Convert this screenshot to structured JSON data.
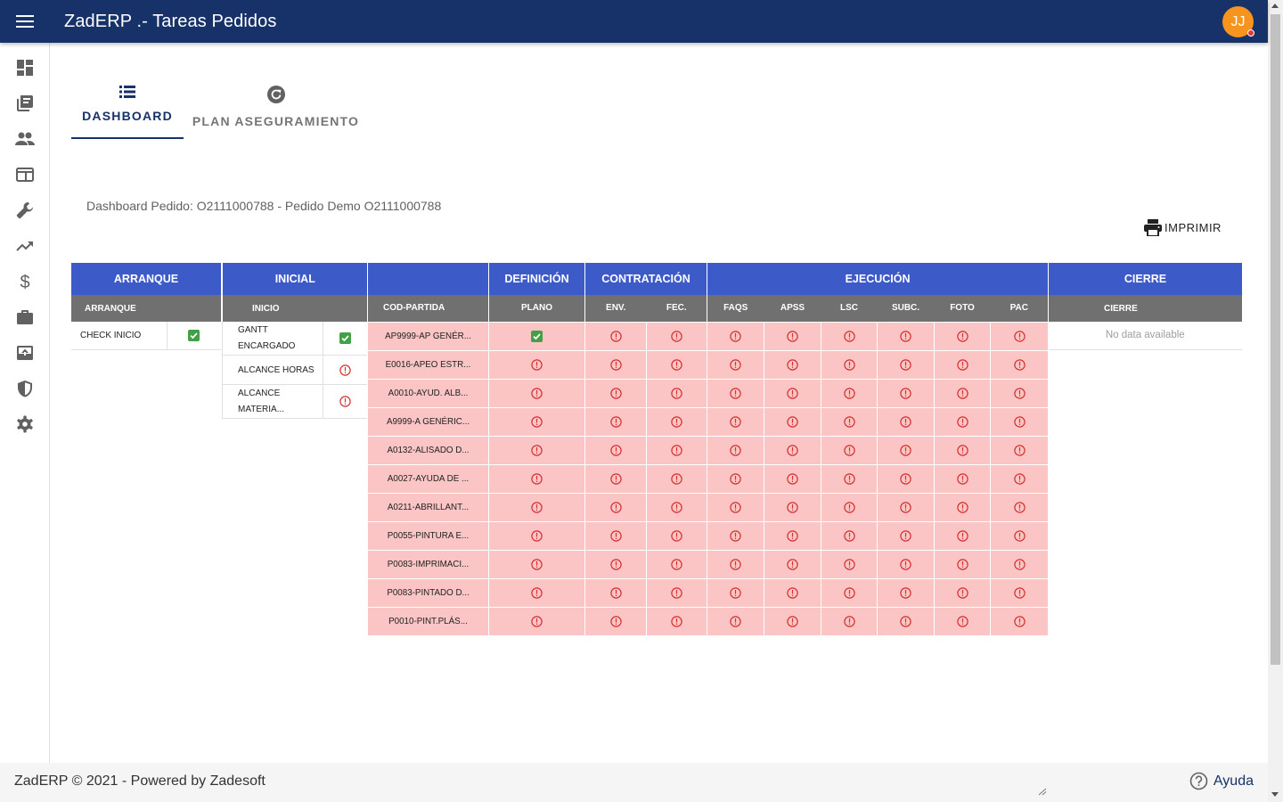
{
  "header": {
    "title": "ZadERP .- Tareas Pedidos",
    "avatar_initials": "JJ",
    "bar_color": "#163268",
    "avatar_color": "#f7941d"
  },
  "sidebar": {
    "items": [
      {
        "icon": "dashboard-icon"
      },
      {
        "icon": "library-icon"
      },
      {
        "icon": "people-icon"
      },
      {
        "icon": "window-icon"
      },
      {
        "icon": "wrench-icon"
      },
      {
        "icon": "trending-up-icon"
      },
      {
        "icon": "dollar-icon"
      },
      {
        "icon": "briefcase-icon"
      },
      {
        "icon": "archive-upload-icon"
      },
      {
        "icon": "shield-icon"
      },
      {
        "icon": "gear-icon"
      }
    ]
  },
  "tabs": [
    {
      "label": "DASHBOARD",
      "icon": "list-icon",
      "active": true
    },
    {
      "label": "PLAN ASEGURAMIENTO",
      "icon": "refresh-circle-icon",
      "active": false
    }
  ],
  "subtitle": "Dashboard Pedido: O2111000788 - Pedido Demo O2111000788",
  "print_label": "IMPRIMIR",
  "arranque": {
    "section": "ARRANQUE",
    "column": "ARRANQUE",
    "rows": [
      {
        "label": "CHECK INICIO",
        "status": "ok"
      }
    ]
  },
  "inicial": {
    "section": "INICIAL",
    "column": "INICIO",
    "rows": [
      {
        "label": "GANTT ENCARGADO",
        "status": "ok"
      },
      {
        "label": "ALCANCE HORAS",
        "status": "error"
      },
      {
        "label": "ALCANCE MATERIA...",
        "status": "error"
      }
    ]
  },
  "main": {
    "sections": [
      "",
      "DEFINICIÓN",
      "CONTRATACIÓN",
      "EJECUCIÓN"
    ],
    "columns": [
      "COD-PARTIDA",
      "PLANO",
      "ENV.",
      "FEC.",
      "FAQS",
      "APSS",
      "LSC",
      "SUBC.",
      "FOTO",
      "PAC"
    ],
    "rows": [
      {
        "code": "AP9999-AP GENÉR...",
        "plano_ok": true
      },
      {
        "code": "E0016-APEO ESTR...",
        "plano_ok": false
      },
      {
        "code": "A0010-AYUD. ALB...",
        "plano_ok": false
      },
      {
        "code": "A9999-A GENÉRIC...",
        "plano_ok": false
      },
      {
        "code": "A0132-ALISADO D...",
        "plano_ok": false
      },
      {
        "code": "A0027-AYUDA DE ...",
        "plano_ok": false
      },
      {
        "code": "A0211-ABRILLANT...",
        "plano_ok": false
      },
      {
        "code": "P0055-PINTURA E...",
        "plano_ok": false
      },
      {
        "code": "P0083-IMPRIMACI...",
        "plano_ok": false
      },
      {
        "code": "P0083-PINTADO D...",
        "plano_ok": false
      },
      {
        "code": "P0010-PINT.PLÁS...",
        "plano_ok": false
      }
    ],
    "row_bg": "#fcc5c5"
  },
  "cierre": {
    "section": "CIERRE",
    "column": "CIERRE",
    "empty_text": "No data available"
  },
  "colors": {
    "header_blue": "#3c5ac8",
    "subheader_gray": "#707070",
    "ok_green": "#43a047",
    "error_red": "#d32f2f"
  },
  "footer": {
    "text": "ZadERP © 2021 - Powered by Zadesoft",
    "help_label": "Ayuda"
  }
}
